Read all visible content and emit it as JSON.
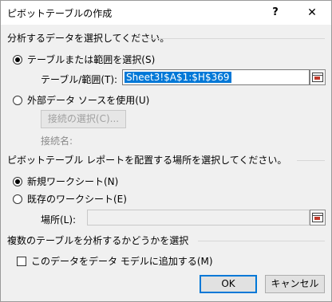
{
  "dialog": {
    "title": "ピボットテーブルの作成",
    "help": "?",
    "close": "✕"
  },
  "section1": {
    "heading": "分析するデータを選択してください。",
    "radio_table": "テーブルまたは範囲を選択(S)",
    "range_label": "テーブル/範囲(T):",
    "range_value": "Sheet3!$A$1:$H$369",
    "radio_external": "外部データ ソースを使用(U)",
    "choose_connection": "接続の選択(C)...",
    "connection_name": "接続名:"
  },
  "section2": {
    "heading": "ピボットテーブル レポートを配置する場所を選択してください。",
    "radio_new": "新規ワークシート(N)",
    "radio_existing": "既存のワークシート(E)",
    "location_label": "場所(L):",
    "location_value": ""
  },
  "section3": {
    "heading": "複数のテーブルを分析するかどうかを選択",
    "add_to_model": "このデータをデータ モデルに追加する(M)"
  },
  "buttons": {
    "ok": "OK",
    "cancel": "キャンセル"
  },
  "icons": {
    "range_picker": "range-picker-icon"
  },
  "colors": {
    "accent": "#0078d7",
    "background": "#f0f0f0"
  }
}
